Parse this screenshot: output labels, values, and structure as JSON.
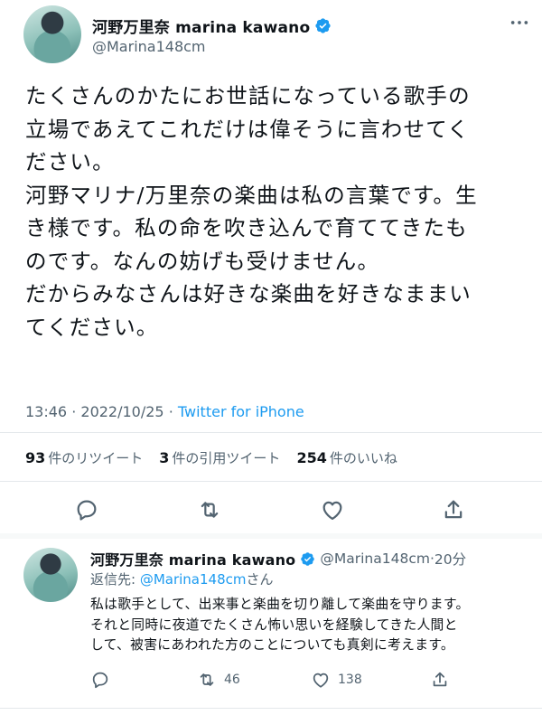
{
  "tweet": {
    "author_name": "河野万里奈 marina kawano",
    "handle": "@Marina148cm",
    "text": "たくさんのかたにお世話になっている歌手の\n立場であえてこれだけは偉そうに言わせてく\nださい。\n河野マリナ/万里奈の楽曲は私の言葉です。生\nき様です。私の命を吹き込んで育ててきたも\nのです。なんの妨げも受けません。\nだからみなさんは好きな楽曲を好きなままい\nてください。",
    "time": "13:46",
    "date": "2022/10/25",
    "separator": "·",
    "source": "Twitter for iPhone",
    "stats": {
      "retweets_count": "93",
      "retweets_label": "件のリツイート",
      "quotes_count": "3",
      "quotes_label": "件の引用ツイート",
      "likes_count": "254",
      "likes_label": "件のいいね"
    }
  },
  "reply": {
    "author_name": "河野万里奈 marina kawano",
    "handle": "@Marina148cm",
    "dot": "·",
    "time": "20分",
    "reply_to_label": "返信先: ",
    "reply_to_handle": "@Marina148cm",
    "reply_to_suffix": "さん",
    "text": "私は歌手として、出来事と楽曲を切り離して楽曲を守ります。\nそれと同時に夜道でたくさん怖い思いを経験してきた人間と\nして、被害にあわれた方のことについても真剣に考えます。",
    "retweet_count": "46",
    "like_count": "138"
  },
  "colors": {
    "accent": "#1d9bf0",
    "text": "#0f1419",
    "secondary": "#536471",
    "divider": "#e4e8eb"
  },
  "icons": [
    "verified-badge-icon",
    "more-options-icon",
    "reply-icon",
    "retweet-icon",
    "like-icon",
    "share-icon"
  ]
}
